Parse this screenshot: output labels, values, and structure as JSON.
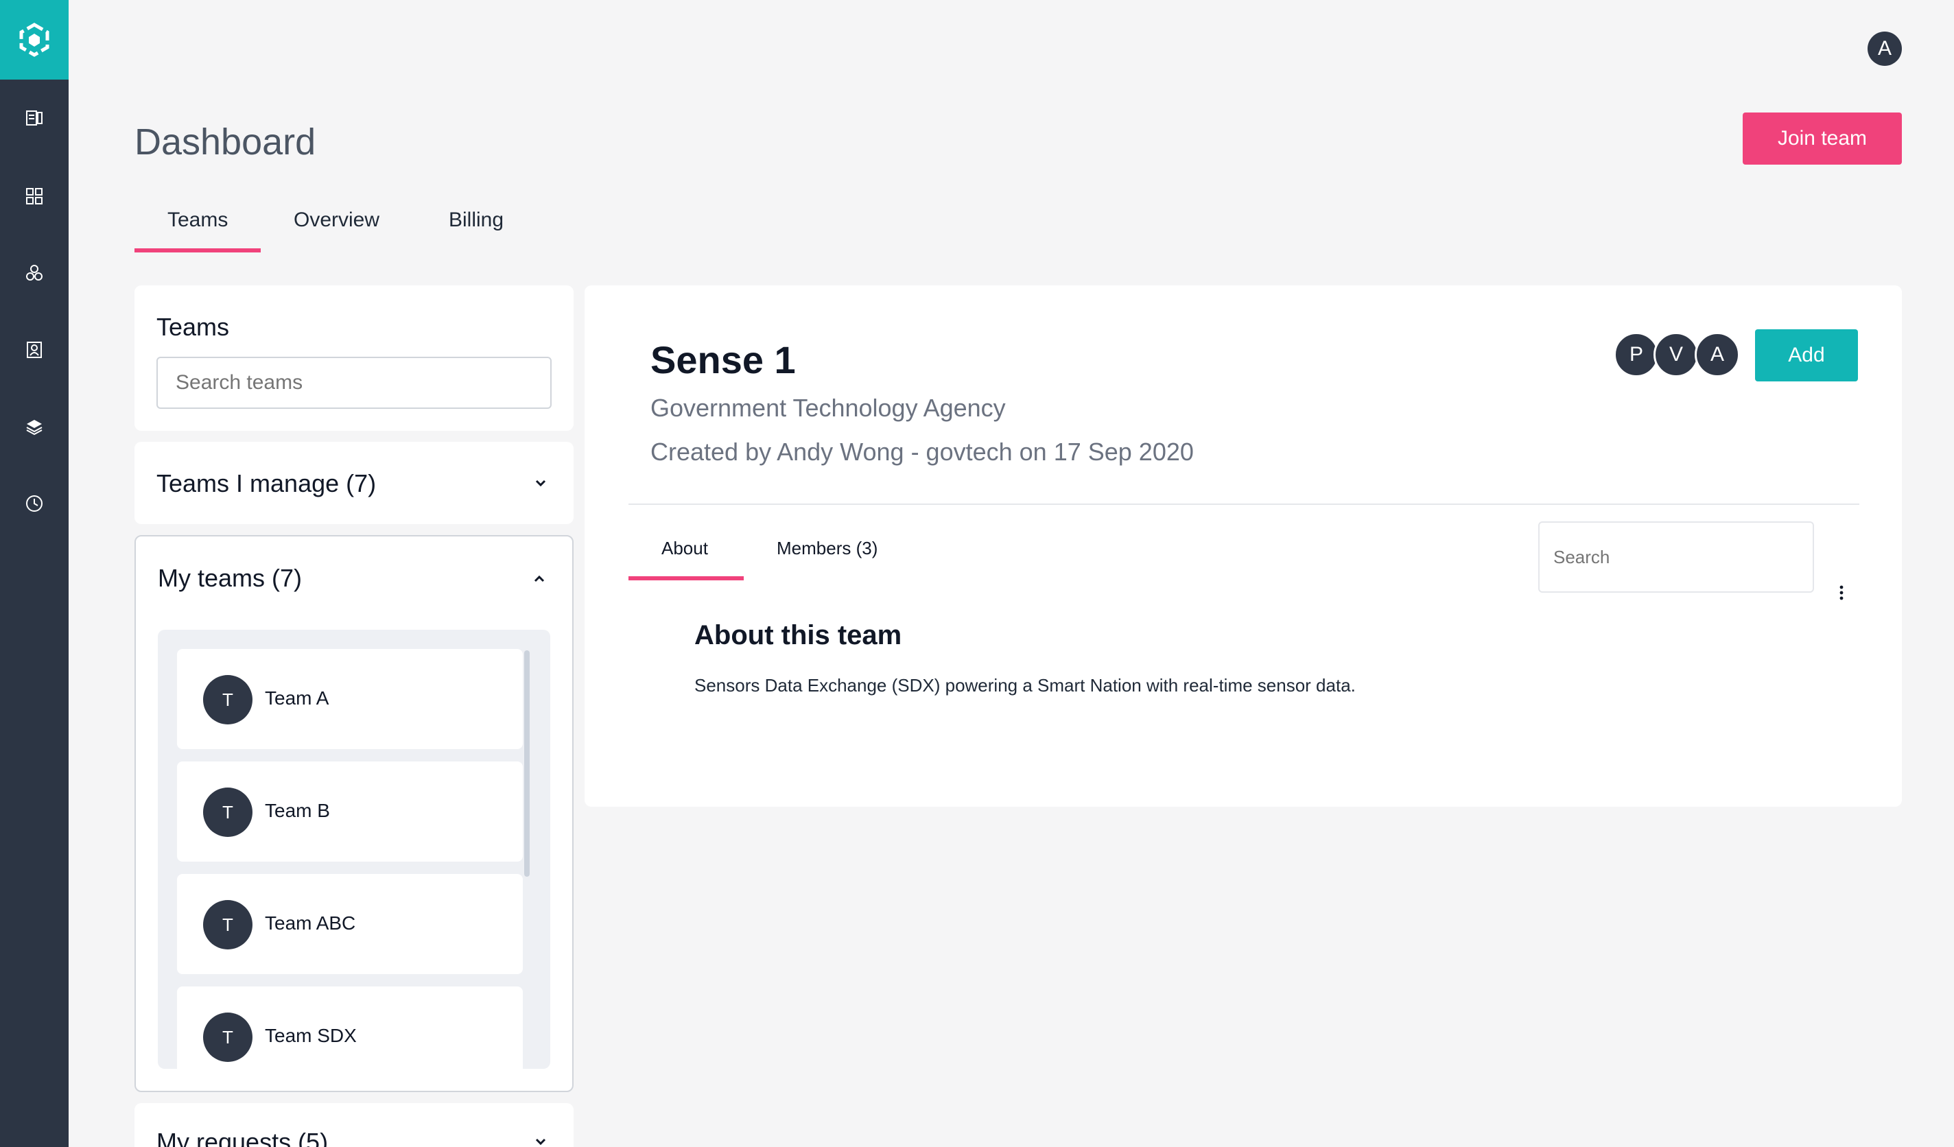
{
  "user": {
    "initial": "A"
  },
  "page": {
    "title": "Dashboard",
    "join_button": "Join team"
  },
  "tabs": [
    {
      "label": "Teams"
    },
    {
      "label": "Overview"
    },
    {
      "label": "Billing"
    }
  ],
  "teams_panel": {
    "title": "Teams",
    "search_placeholder": "Search teams"
  },
  "manage_panel": {
    "title": "Teams I manage (7)"
  },
  "my_teams_panel": {
    "title": "My teams (7)",
    "items": [
      {
        "initial": "T",
        "name": "Team A"
      },
      {
        "initial": "T",
        "name": "Team B"
      },
      {
        "initial": "T",
        "name": "Team ABC"
      },
      {
        "initial": "T",
        "name": "Team SDX"
      }
    ]
  },
  "requests_panel": {
    "title": "My requests (5)"
  },
  "team_detail": {
    "name": "Sense 1",
    "organisation": "Government Technology Agency",
    "created": "Created by Andy Wong - govtech on 17 Sep 2020",
    "member_initials": [
      "P",
      "V",
      "A"
    ],
    "add_button": "Add",
    "tabs": [
      {
        "label": "About"
      },
      {
        "label": "Members (3)"
      }
    ],
    "search_placeholder": "Search",
    "about_title": "About this team",
    "about_description": "Sensors Data Exchange (SDX) powering a Smart Nation with real-time sensor data."
  },
  "colors": {
    "sidebar": "#2c3544",
    "brand_teal": "#12b5b5",
    "accent_pink": "#f0427b",
    "avatar": "#2f3746"
  }
}
